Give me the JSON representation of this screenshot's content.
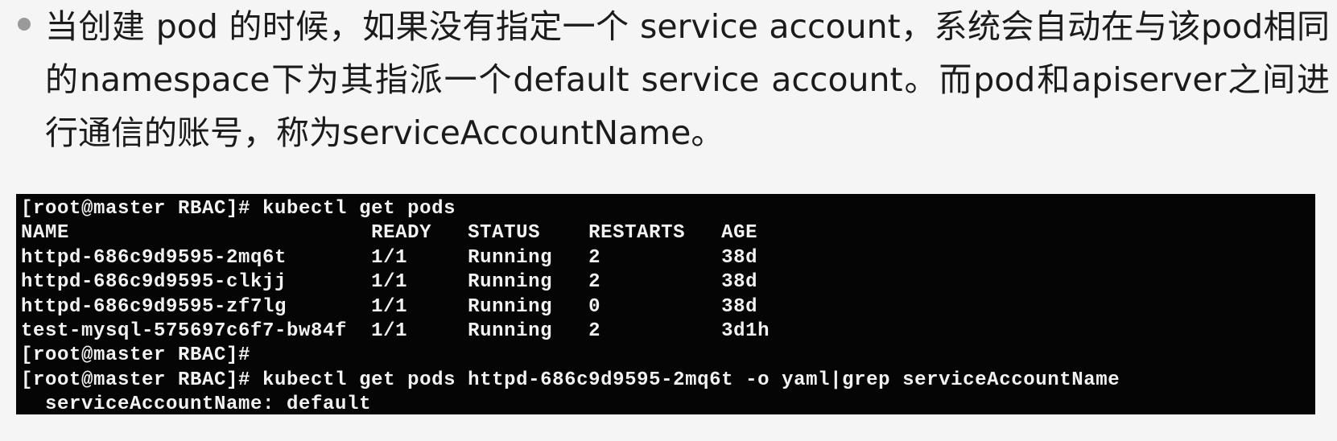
{
  "slide": {
    "bullet_text": "当创建 pod 的时候，如果没有指定一个 service account，系统会自动在与该pod相同的namespace下为其指派一个default service account。而pod和apiserver之间进行通信的账号，称为serviceAccountName。"
  },
  "terminal": {
    "lines": [
      "[root@master RBAC]# kubectl get pods",
      "NAME                         READY   STATUS    RESTARTS   AGE",
      "httpd-686c9d9595-2mq6t       1/1     Running   2          38d",
      "httpd-686c9d9595-clkjj       1/1     Running   2          38d",
      "httpd-686c9d9595-zf7lg       1/1     Running   0          38d",
      "test-mysql-575697c6f7-bw84f  1/1     Running   2          3d1h",
      "[root@master RBAC]#",
      "[root@master RBAC]# kubectl get pods httpd-686c9d9595-2mq6t -o yaml|grep serviceAccountName",
      "  serviceAccountName: default"
    ]
  }
}
